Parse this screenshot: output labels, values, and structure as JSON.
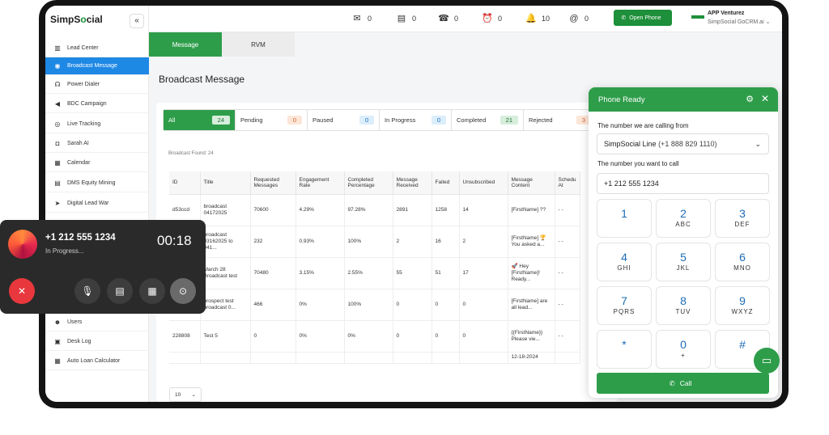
{
  "app": {
    "logo_a": "SimpS",
    "logo_b": "o",
    "logo_c": "cial",
    "collapse_glyph": "«"
  },
  "sidebar": {
    "items": [
      {
        "label": "Lead Center",
        "icon": "building-icon"
      },
      {
        "label": "Broadcast Message",
        "icon": "broadcast-icon"
      },
      {
        "label": "Power Dialer",
        "icon": "headset-icon"
      },
      {
        "label": "BDC Campaign",
        "icon": "megaphone-icon"
      },
      {
        "label": "Live Tracking",
        "icon": "tracking-icon"
      },
      {
        "label": "Sarah AI",
        "icon": "robot-icon"
      },
      {
        "label": "Calendar",
        "icon": "calendar-icon"
      },
      {
        "label": "DMS Equity Mining",
        "icon": "database-icon"
      },
      {
        "label": "Digital Lead War",
        "icon": "rocket-icon"
      },
      {
        "label": "Users",
        "icon": "users-icon"
      },
      {
        "label": "Desk Log",
        "icon": "desk-log-icon"
      },
      {
        "label": "Auto Loan Calculator",
        "icon": "calculator-icon"
      }
    ]
  },
  "topbar": {
    "mail_count": "0",
    "chat_count": "0",
    "missed_call_count": "0",
    "alarm_count": "0",
    "bell_count": "10",
    "at_count": "0",
    "open_phone": "Open Phone",
    "account_name": "APP Venturez",
    "account_sub": "SimpSocial GoCRM.ai"
  },
  "tabs": {
    "message": "Message",
    "rvm": "RVM"
  },
  "page": {
    "title": "Broadcast Message",
    "found": "Broadcast Found: 24"
  },
  "filters": [
    {
      "label": "All",
      "count": "24"
    },
    {
      "label": "Pending",
      "count": "0"
    },
    {
      "label": "Paused",
      "count": "0"
    },
    {
      "label": "In Progress",
      "count": "0"
    },
    {
      "label": "Completed",
      "count": "21"
    },
    {
      "label": "Rejected",
      "count": "3"
    }
  ],
  "table": {
    "headers": [
      "ID",
      "Title",
      "Requested Messages",
      "Engagement Rate",
      "Completed Percentage",
      "Message Received",
      "Failed",
      "Unsubscribed",
      "Message Content",
      "Schedu At"
    ],
    "rows": [
      [
        "d53ccd",
        "broadcast 04172025",
        "70600",
        "4.29%",
        "97.28%",
        "2891",
        "1258",
        "14",
        "[FirstName] ??",
        "- -"
      ],
      [
        "",
        "broadcast 03162025 to 041...",
        "232",
        "0.93%",
        "100%",
        "2",
        "16",
        "2",
        "[FirstName] 🏆 You asked a...",
        "- -"
      ],
      [
        "",
        "March 28 Broadcast test",
        "70480",
        "3.15%",
        "2.55%",
        "55",
        "51",
        "17",
        "🚀 Hey [FirstName]! Ready...",
        "- -"
      ],
      [
        "",
        "prospect test broadcast 0...",
        "466",
        "0%",
        "100%",
        "0",
        "0",
        "0",
        "[FirstName] are all lead...",
        "- -"
      ],
      [
        "228808",
        "Test 5",
        "0",
        "0%",
        "0%",
        "0",
        "0",
        "0",
        "{{FirstName}} Please vie...",
        "- -"
      ],
      [
        "",
        "",
        "",
        "",
        "",
        "",
        "",
        "",
        "12-18-2024",
        ""
      ]
    ]
  },
  "pager": {
    "size": "10"
  },
  "phone": {
    "title": "Phone Ready",
    "calling_from_label": "The number we are calling from",
    "line_name": "SimpSocial Line",
    "line_number": "(+1 888 829 1110)",
    "to_call_label": "The number you want to call",
    "to_call_value": "+1 212 555 1234",
    "keys": [
      {
        "d": "1",
        "l": ""
      },
      {
        "d": "2",
        "l": "ABC"
      },
      {
        "d": "3",
        "l": "DEF"
      },
      {
        "d": "4",
        "l": "GHI"
      },
      {
        "d": "5",
        "l": "JKL"
      },
      {
        "d": "6",
        "l": "MNO"
      },
      {
        "d": "7",
        "l": "PQRS"
      },
      {
        "d": "8",
        "l": "TUV"
      },
      {
        "d": "9",
        "l": "WXYZ"
      },
      {
        "d": "*",
        "l": ""
      },
      {
        "d": "0",
        "l": "+"
      },
      {
        "d": "#",
        "l": ""
      }
    ],
    "call_label": "Call"
  },
  "call_widget": {
    "number": "+1 212 555 1234",
    "status": "In Progress...",
    "timer": "00:18"
  }
}
